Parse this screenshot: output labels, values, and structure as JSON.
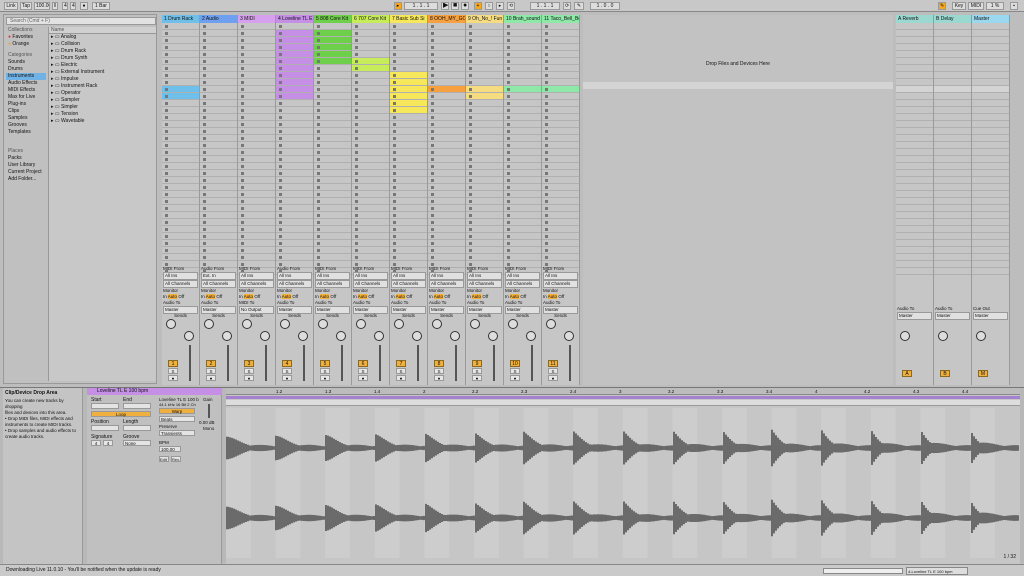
{
  "toolbar": {
    "link": "Link",
    "tap": "Tap",
    "tempo": "100.00",
    "sig_num": "4",
    "sig_den": "4",
    "metro_icon": "metronome-icon",
    "quant": "1 Bar",
    "pos": [
      "1",
      ".",
      "1",
      ".",
      "1"
    ],
    "loop_start": [
      "1",
      ".",
      "1",
      ".",
      "1"
    ],
    "loop_len": [
      "1",
      ".",
      "0",
      ".",
      "0"
    ],
    "key": "Key",
    "midi": "MIDI",
    "cpu": "1 %",
    "play_icon": "play-icon",
    "stop_icon": "stop-icon",
    "rec_icon": "record-icon"
  },
  "browser": {
    "search_placeholder": "Search (Cmd + F)",
    "collections_header": "Collections",
    "collections": [
      "Favorites",
      "Orange"
    ],
    "categories_header": "Categories",
    "categories": [
      "Sounds",
      "Drums",
      "Instruments",
      "Audio Effects",
      "MIDI Effects",
      "Max for Live",
      "Plug-ins",
      "Clips",
      "Samples",
      "Grooves",
      "Templates"
    ],
    "selected_category": "Instruments",
    "places_header": "Places",
    "places": [
      "Packs",
      "User Library",
      "Current Project",
      "Add Folder..."
    ],
    "name_header": "Name",
    "items": [
      "Analog",
      "Collision",
      "Drum Rack",
      "Drum Synth",
      "Electric",
      "External Instrument",
      "Impulse",
      "Instrument Rack",
      "Operator",
      "Sampler",
      "Simpler",
      "Tension",
      "Wavetable"
    ]
  },
  "tracks": [
    {
      "name": "1 Drum Rack",
      "color": "#6ec0ea",
      "num": "1"
    },
    {
      "name": "2 Audio",
      "color": "#6fa0f0",
      "num": "2"
    },
    {
      "name": "3 MIDI",
      "color": "#d6a0ee",
      "num": "3"
    },
    {
      "name": "4 Loveline TL E",
      "color": "#c58fe6",
      "num": "4"
    },
    {
      "name": "5 808 Core Kit",
      "color": "#6ed04a",
      "num": "5"
    },
    {
      "name": "6 707 Core Kit",
      "color": "#c6ec5a",
      "num": "6"
    },
    {
      "name": "7 Basic Sub Si",
      "color": "#f6e85a",
      "num": "7"
    },
    {
      "name": "8 OOH_MY_GO",
      "color": "#f6a040",
      "num": "8"
    },
    {
      "name": "9 Oh_No_! Fun",
      "color": "#f6dc80",
      "num": "9"
    },
    {
      "name": "10 Brah_sound",
      "color": "#8ee8a8",
      "num": "10"
    },
    {
      "name": "11 Taco_Bell_Bo",
      "color": "#8ee8a8",
      "num": "11"
    }
  ],
  "return_tracks": [
    {
      "name": "A Reverb",
      "color": "#9ad8d0",
      "num": "A"
    },
    {
      "name": "B Delay",
      "color": "#9ad8d0",
      "num": "B"
    },
    {
      "name": "Master",
      "color": "#9ad8f0",
      "num": "M"
    }
  ],
  "loveline_clips": [
    "Loveline TL E",
    "Loveline TL E",
    "Loveline TL E",
    "Loveline TL E",
    "Loveline TL E",
    "Loveline TL E",
    "Loveline TL E",
    "Loveline TL E",
    "Loveline TL E",
    "Loveline TL E"
  ],
  "drop_text": "Drop Files and Devices Here",
  "io": {
    "midi_from": "MIDI From",
    "audio_from": "Audio From",
    "all_ins": "All Ins",
    "ext_in": "Ext. In",
    "all_channels": "All Channels",
    "monitor": "Monitor",
    "in": "In",
    "auto": "Auto",
    "off": "Off",
    "audio_to": "Audio To",
    "midi_to": "MIDI To",
    "master": "Master",
    "no_output": "No Output",
    "sends": "Sends",
    "cue_out": "Cue Out",
    "master_out": "Master Out"
  },
  "info_view": {
    "title": "Clip/Device Drop Area",
    "lines": [
      "You can create new tracks by dropping",
      "files and devices into this area.",
      "Drop MIDI files, MIDI effects and",
      "instruments to create MIDI tracks.",
      "Drop samples and audio effects to",
      "create audio tracks."
    ]
  },
  "clip": {
    "name": "Loveline TL E 100 bpm",
    "start": "Start",
    "end": "End",
    "loop": "Loop",
    "position": "Position",
    "length": "Length",
    "signature": "Signature",
    "groove": "Groove",
    "none": "None",
    "warp": "Warp",
    "beats": "Beats",
    "preserve": "Preserve",
    "transients": "Transients",
    "bpm_label": "BPM",
    "bpm": "100.00",
    "gain": "Gain",
    "gain_val": "0.00 dB",
    "mode": "Mono",
    "sample_info": "Loveline TL E 100 b",
    "sample_rate": "44.1 kHz  16 Bit  2 Ch",
    "edit": "Edit",
    "sig_4": "4",
    "rev": "Rev."
  },
  "ruler": [
    "1.2",
    "1.3",
    "1.4",
    "2",
    "2.2",
    "2.3",
    "2.4",
    "3",
    "3.2",
    "3.3",
    "3.4",
    "4",
    "4.2",
    "4.3",
    "4.4"
  ],
  "page": "1 / 32",
  "status": {
    "message": "Downloading Live 11.0.10 - You'll be notified when the update is ready",
    "track": "4-Loveline TL E 100 bpm"
  }
}
